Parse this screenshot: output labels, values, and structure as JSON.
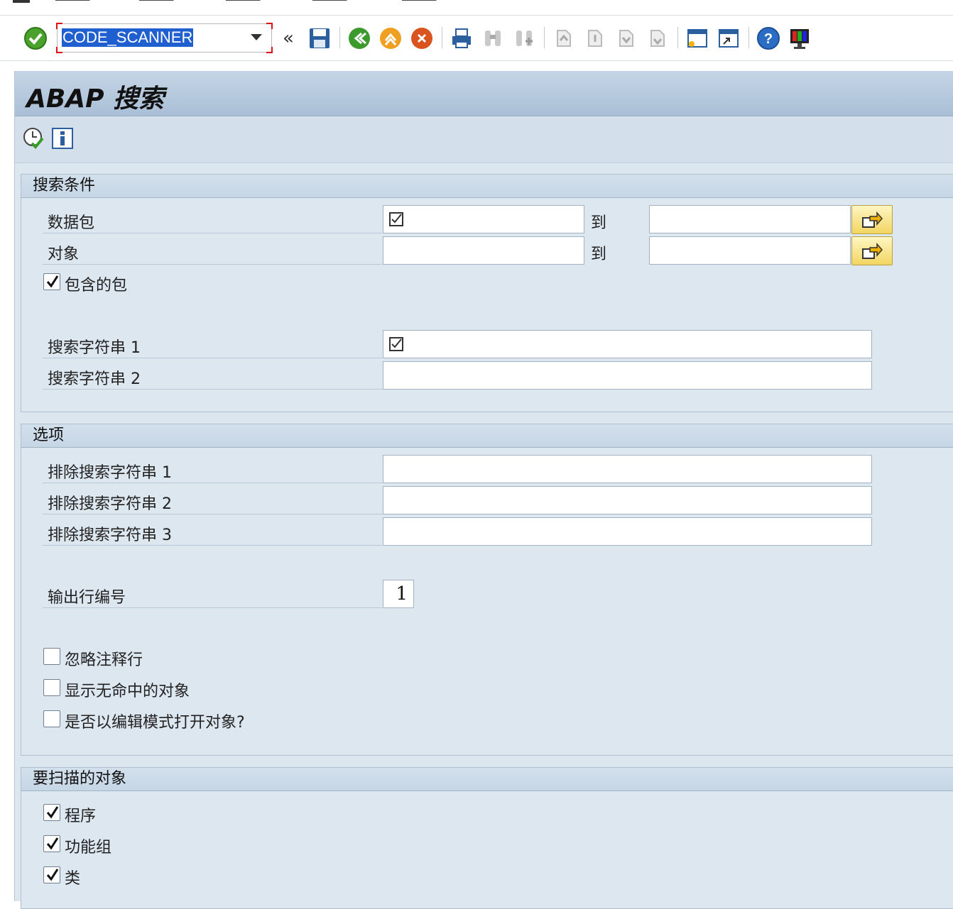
{
  "toolbar": {
    "command_value": "CODE_SCANNER"
  },
  "page": {
    "title": "ABAP 搜索"
  },
  "search_group": {
    "header": "搜索条件",
    "package_label": "数据包",
    "object_label": "对象",
    "to_label": "到",
    "include_subpackages_label": "包含的包",
    "include_subpackages_checked": true,
    "search_string_1_label": "搜索字符串 1",
    "search_string_2_label": "搜索字符串 2"
  },
  "options_group": {
    "header": "选项",
    "exclude_1_label": "排除搜索字符串 1",
    "exclude_2_label": "排除搜索字符串 2",
    "exclude_3_label": "排除搜索字符串 3",
    "output_line_label": "输出行编号",
    "output_line_value": "1",
    "ignore_comments_label": "忽略注释行",
    "show_no_hits_label": "显示无命中的对象",
    "open_edit_mode_label": "是否以编辑模式打开对象?"
  },
  "objects_group": {
    "header": "要扫描的对象",
    "programs_label": "程序",
    "function_groups_label": "功能组",
    "classes_label": "类"
  }
}
